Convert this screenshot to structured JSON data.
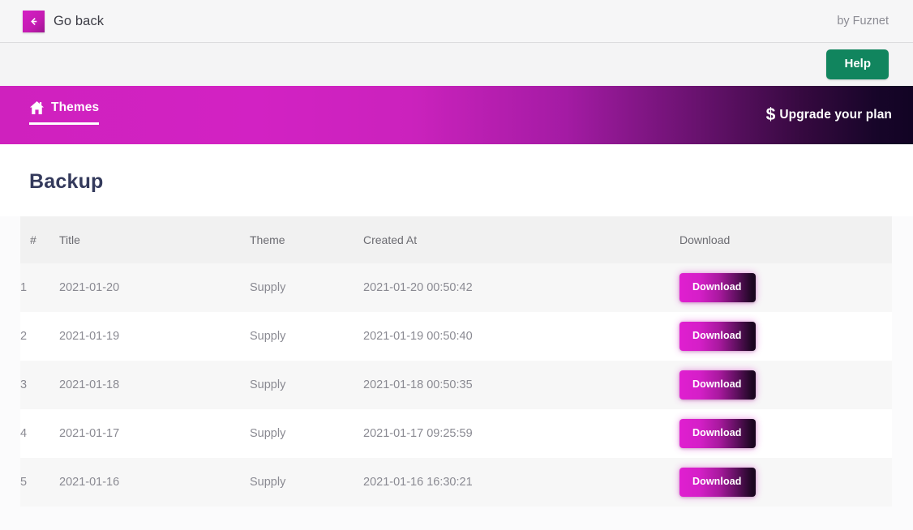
{
  "topbar": {
    "back_label": "Go back",
    "back_icon": "arrow-left-icon",
    "byline": "by Fuznet"
  },
  "helpbar": {
    "help_label": "Help",
    "help_color": "#11855e"
  },
  "navbar": {
    "tab_label": "Themes",
    "tab_icon": "home-icon",
    "upgrade_label": "Upgrade your plan",
    "upgrade_icon": "dollar-icon",
    "gradient_start": "#cf21be",
    "gradient_end": "#120424"
  },
  "page": {
    "title": "Backup",
    "title_color": "#343a5c"
  },
  "table": {
    "columns": [
      "#",
      "Title",
      "Theme",
      "Created At",
      "Download"
    ],
    "download_label": "Download",
    "rows": [
      {
        "num": "1",
        "title": "2021-01-20",
        "theme": "Supply",
        "created_at": "2021-01-20 00:50:42",
        "action": "Download"
      },
      {
        "num": "2",
        "title": "2021-01-19",
        "theme": "Supply",
        "created_at": "2021-01-19 00:50:40",
        "action": "Download"
      },
      {
        "num": "3",
        "title": "2021-01-18",
        "theme": "Supply",
        "created_at": "2021-01-18 00:50:35",
        "action": "Download"
      },
      {
        "num": "4",
        "title": "2021-01-17",
        "theme": "Supply",
        "created_at": "2021-01-17 09:25:59",
        "action": "Download"
      },
      {
        "num": "5",
        "title": "2021-01-16",
        "theme": "Supply",
        "created_at": "2021-01-16 16:30:21",
        "action": "Download"
      }
    ]
  }
}
